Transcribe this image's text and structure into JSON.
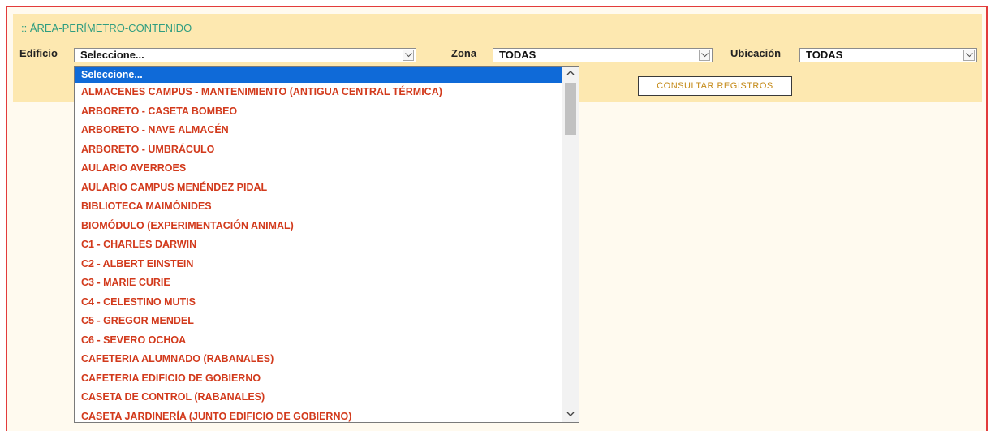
{
  "panel": {
    "title": ":: ÁREA-PERÍMETRO-CONTENIDO"
  },
  "filters": {
    "edificio_label": "Edificio",
    "edificio_value": "Seleccione...",
    "zona_label": "Zona",
    "zona_value": "TODAS",
    "ubicacion_label": "Ubicación",
    "ubicacion_value": "TODAS"
  },
  "buttons": {
    "consultar": "CONSULTAR REGISTROS"
  },
  "dropdown": {
    "selected_index": 0,
    "options": [
      "Seleccione...",
      "ALMACENES CAMPUS - MANTENIMIENTO (ANTIGUA CENTRAL TÉRMICA)",
      "ARBORETO - CASETA BOMBEO",
      "ARBORETO - NAVE ALMACÉN",
      "ARBORETO - UMBRÁCULO",
      "AULARIO AVERROES",
      "AULARIO CAMPUS MENÉNDEZ PIDAL",
      "BIBLIOTECA MAIMÓNIDES",
      "BIOMÓDULO (EXPERIMENTACIÓN ANIMAL)",
      "C1 - CHARLES DARWIN",
      "C2 - ALBERT EINSTEIN",
      "C3 - MARIE CURIE",
      "C4 - CELESTINO MUTIS",
      "C5 - GREGOR MENDEL",
      "C6 - SEVERO OCHOA",
      "CAFETERIA ALUMNADO (RABANALES)",
      "CAFETERIA EDIFICIO DE GOBIERNO",
      "CASETA DE CONTROL (RABANALES)",
      "CASETA JARDINERÍA (JUNTO EDIFICIO DE GOBIERNO)"
    ]
  },
  "colors": {
    "frame_border": "#e23b3b",
    "panel_bg": "#fde8b0",
    "title_color": "#2f9d80",
    "option_text": "#d23a1c",
    "selected_bg": "#0f6ad8",
    "button_text": "#c48a18"
  }
}
